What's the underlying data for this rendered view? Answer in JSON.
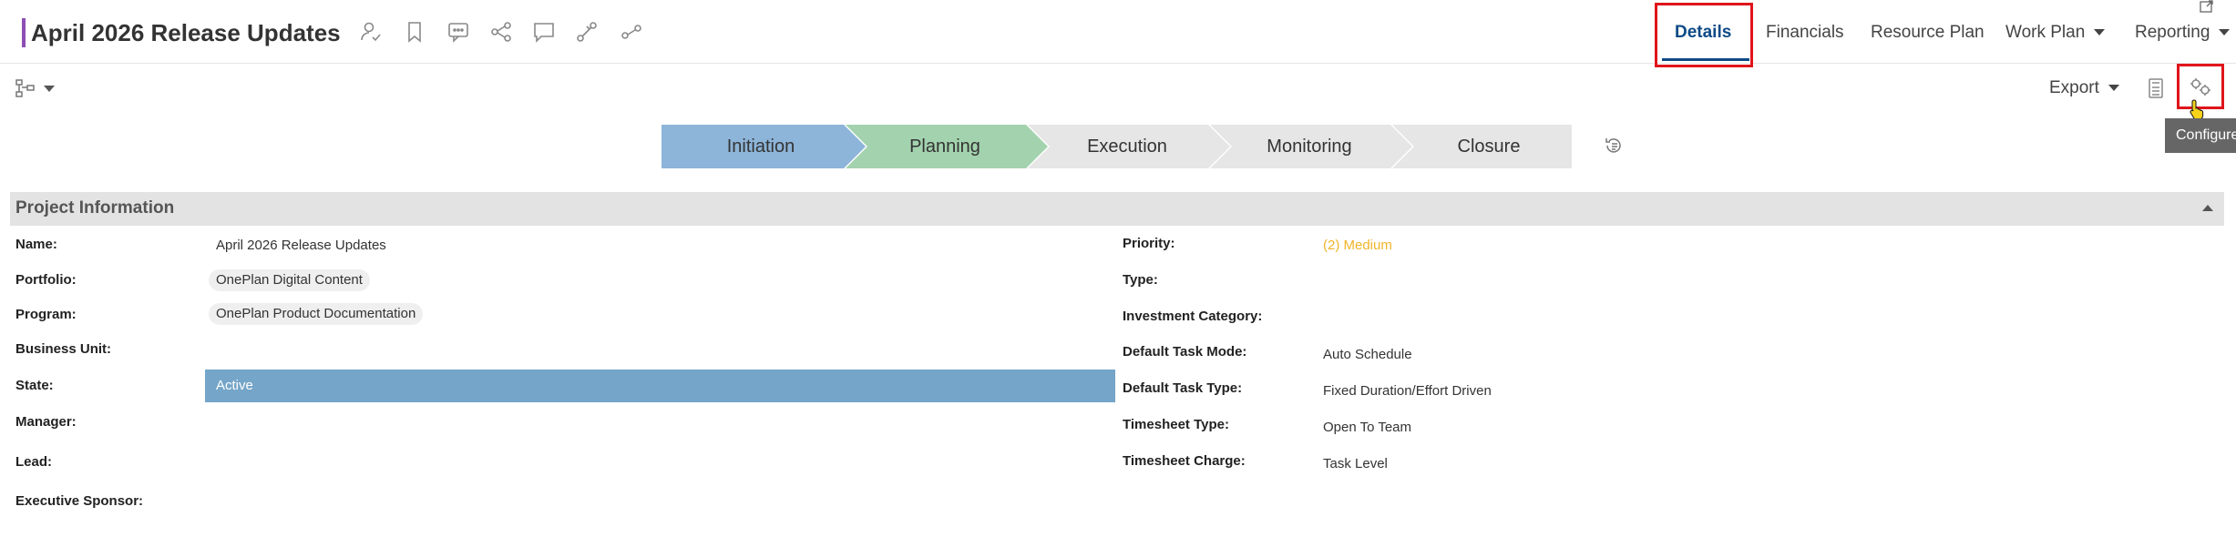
{
  "header": {
    "title": "April 2026 Release Updates",
    "accent_color": "#8e4fb5",
    "icons": [
      "person-check-icon",
      "bookmark-icon",
      "comment-dots-icon",
      "share-icon",
      "chat-icon",
      "link-icon",
      "connect-icon"
    ]
  },
  "nav": {
    "tabs": [
      {
        "label": "Details",
        "active": true
      },
      {
        "label": "Financials"
      },
      {
        "label": "Resource Plan"
      },
      {
        "label": "Work Plan",
        "dropdown": true
      },
      {
        "label": "Reporting",
        "dropdown": true
      }
    ],
    "active_color": "#0e4a86",
    "highlight_color": "#e0141b"
  },
  "toolbar": {
    "export_label": "Export",
    "tooltip": "Configure"
  },
  "stages": [
    {
      "label": "Initiation",
      "color": "#8db4d9"
    },
    {
      "label": "Planning",
      "color": "#a3d3ae"
    },
    {
      "label": "Execution",
      "color": "#e6e6e6"
    },
    {
      "label": "Monitoring",
      "color": "#e6e6e6"
    },
    {
      "label": "Closure",
      "color": "#e6e6e6"
    }
  ],
  "section": {
    "title": "Project Information"
  },
  "fields_left": [
    {
      "label": "Name:",
      "value": "April 2026 Release Updates"
    },
    {
      "label": "Portfolio:",
      "value": "OnePlan Digital Content"
    },
    {
      "label": "Program:",
      "value": "OnePlan Product Documentation"
    },
    {
      "label": "Business Unit:",
      "value": ""
    },
    {
      "label": "State:",
      "value": "Active"
    },
    {
      "label": "Manager:",
      "value": ""
    },
    {
      "label": "Lead:",
      "value": ""
    },
    {
      "label": "Executive Sponsor:",
      "value": ""
    }
  ],
  "fields_right": [
    {
      "label": "Priority:",
      "value": "(2) Medium",
      "color": "#f0b429"
    },
    {
      "label": "Type:",
      "value": ""
    },
    {
      "label": "Investment Category:",
      "value": ""
    },
    {
      "label": "Default Task Mode:",
      "value": "Auto Schedule"
    },
    {
      "label": "Default Task Type:",
      "value": "Fixed Duration/Effort Driven"
    },
    {
      "label": "Timesheet Type:",
      "value": "Open To Team"
    },
    {
      "label": "Timesheet Charge:",
      "value": "Task Level"
    }
  ]
}
